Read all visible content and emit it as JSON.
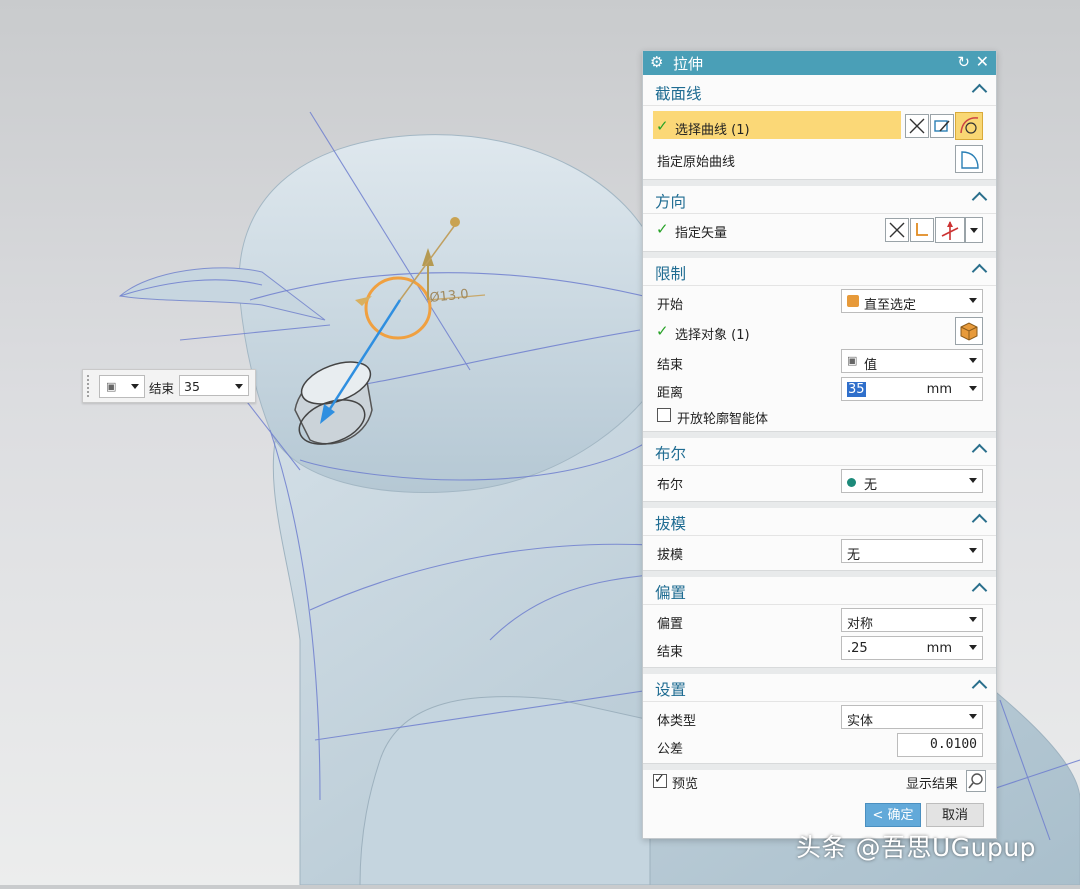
{
  "viewport": {
    "dimension_label": "Ø13.0",
    "mini_toolbar": {
      "type_icon": "value-cube-icon",
      "label": "结束",
      "value": "35"
    }
  },
  "dialog": {
    "title": "拉伸",
    "title_icons": [
      "gear-icon",
      "reset-icon",
      "close-icon"
    ],
    "close_glyph": "✕",
    "reset_glyph": "↻",
    "groups": {
      "section": {
        "title": "截面线",
        "select_curve": "选择曲线 (1)",
        "specify_origin": "指定原始曲线"
      },
      "direction": {
        "title": "方向",
        "specify_vector": "指定矢量"
      },
      "limits": {
        "title": "限制",
        "start_label": "开始",
        "start_value": "直至选定",
        "select_object": "选择对象 (1)",
        "end_label": "结束",
        "end_value": "值",
        "distance_label": "距离",
        "distance_value": "35",
        "distance_unit": "mm",
        "open_profile": "开放轮廓智能体",
        "open_profile_checked": false
      },
      "boolean": {
        "title": "布尔",
        "label": "布尔",
        "value": "无"
      },
      "draft": {
        "title": "拔模",
        "label": "拔模",
        "value": "无"
      },
      "offset": {
        "title": "偏置",
        "offset_label": "偏置",
        "offset_value": "对称",
        "end_label": "结束",
        "end_value": ".25",
        "end_unit": "mm"
      },
      "settings": {
        "title": "设置",
        "body_type_label": "体类型",
        "body_type_value": "实体",
        "tolerance_label": "公差",
        "tolerance_value": "0.0100"
      }
    },
    "preview_label": "预览",
    "preview_checked": true,
    "show_result": "显示结果",
    "ok": "< 确定 >",
    "cancel": "取消"
  },
  "watermark": "头条 @吾思UGupup",
  "colors": {
    "title_bar": "#4a9fb7",
    "group_title": "#1f6c92",
    "selected_row": "#fbd877",
    "ok_button": "#62a9d9",
    "model_surface": "#b9cbd6",
    "curve_lines": "#6f7fcf",
    "dimension_circle": "#f0a040",
    "vector_arrow": "#2f8fe0"
  }
}
